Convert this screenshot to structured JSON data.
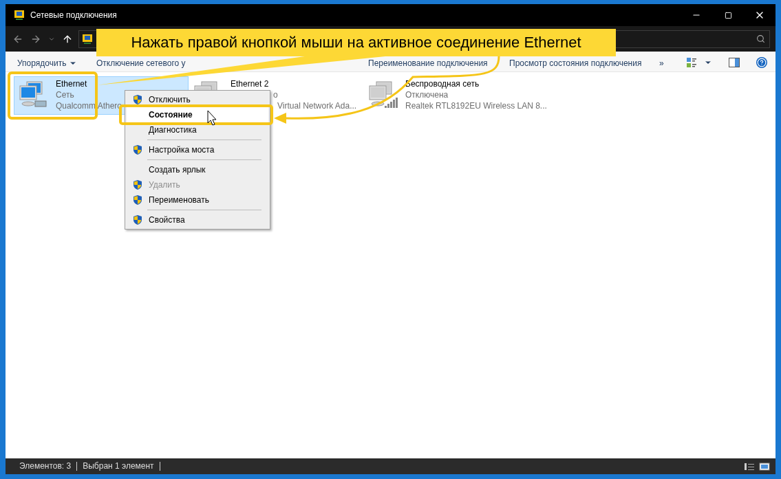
{
  "window": {
    "title": "Сетевые подключения"
  },
  "toolbar": {
    "items": [
      {
        "label": "Упорядочить",
        "kind": "dropdown"
      },
      {
        "label": "Отключение сетевого у",
        "kind": "command"
      },
      {
        "label": "Переименование подключения",
        "kind": "command"
      },
      {
        "label": "Просмотр состояния подключения",
        "kind": "command"
      },
      {
        "label": "»",
        "kind": "more"
      }
    ]
  },
  "connections": [
    {
      "name": "Ethernet",
      "status": "Сеть",
      "device": "Qualcomm Athero",
      "selected": true,
      "covered": false,
      "kind": "wired"
    },
    {
      "name": "Ethernet 2",
      "status": "о",
      "device": "Virtual Network Ada...",
      "selected": false,
      "covered": true,
      "kind": "wired-off"
    },
    {
      "name": "Беспроводная сеть",
      "status": "Отключена",
      "device": "Realtek RTL8192EU Wireless LAN 8...",
      "selected": false,
      "covered": false,
      "kind": "wireless"
    }
  ],
  "context_menu": {
    "items": [
      {
        "kind": "item",
        "label": "Отключить",
        "shield": true,
        "bold": false,
        "selected": false,
        "disabled": false
      },
      {
        "kind": "item",
        "label": "Состояние",
        "shield": false,
        "bold": true,
        "selected": true,
        "disabled": false
      },
      {
        "kind": "item",
        "label": "Диагностика",
        "shield": false,
        "bold": false,
        "selected": false,
        "disabled": false
      },
      {
        "kind": "separator"
      },
      {
        "kind": "item",
        "label": "Настройка моста",
        "shield": true,
        "bold": false,
        "selected": false,
        "disabled": false
      },
      {
        "kind": "separator"
      },
      {
        "kind": "item",
        "label": "Создать ярлык",
        "shield": false,
        "bold": false,
        "selected": false,
        "disabled": false
      },
      {
        "kind": "item",
        "label": "Удалить",
        "shield": true,
        "bold": false,
        "selected": false,
        "disabled": true
      },
      {
        "kind": "item",
        "label": "Переименовать",
        "shield": true,
        "bold": false,
        "selected": false,
        "disabled": false
      },
      {
        "kind": "separator"
      },
      {
        "kind": "item",
        "label": "Свойства",
        "shield": true,
        "bold": false,
        "selected": false,
        "disabled": false
      }
    ]
  },
  "callout": {
    "text": "Нажать правой кнопкой мыши на активное соединение Ethernet"
  },
  "status_bar": {
    "items": [
      "Элементов: 3",
      "Выбран 1 элемент"
    ]
  }
}
